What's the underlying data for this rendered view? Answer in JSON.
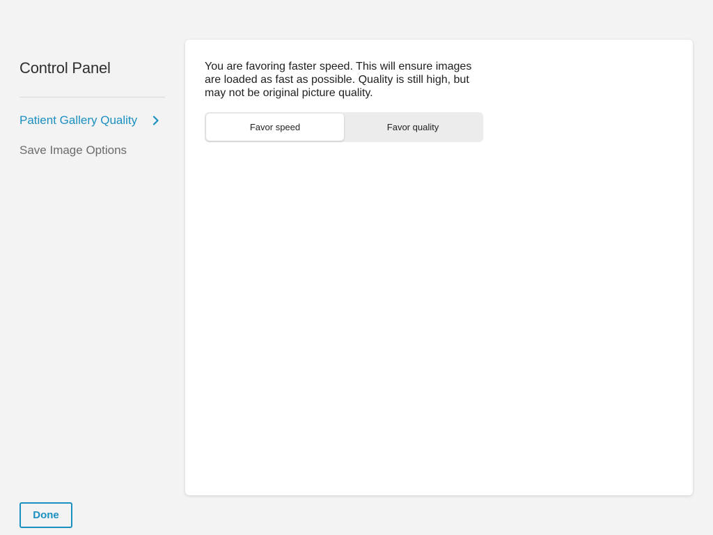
{
  "sidebar": {
    "title": "Control Panel",
    "items": [
      {
        "label": "Patient Gallery Quality",
        "active": true,
        "icon": "chevron-right-icon"
      },
      {
        "label": "Save Image Options",
        "active": false
      }
    ],
    "done_label": "Done"
  },
  "main": {
    "description": "You are favoring faster speed. This will ensure images are loaded as fast as possible. Quality is still high, but may not be original picture quality.",
    "segments": [
      {
        "label": "Favor speed",
        "selected": true
      },
      {
        "label": "Favor quality",
        "selected": false
      }
    ]
  },
  "colors": {
    "accent": "#1a8fc1",
    "background": "#f3f3f3",
    "card": "#ffffff",
    "inactive_text": "#6b6b6b"
  }
}
